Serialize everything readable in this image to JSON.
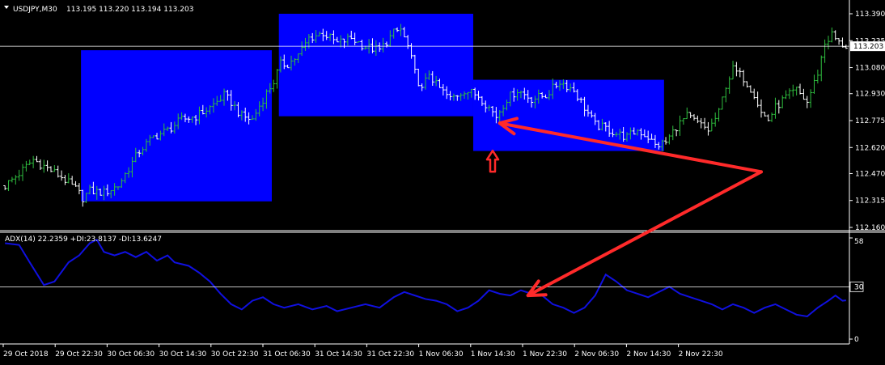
{
  "header": {
    "symbol_label": "USDJPY,M30",
    "ohlc_label": "113.195 113.220 113.194 113.203",
    "menu_icon": "triangle-down-icon"
  },
  "indicator": {
    "label": "ADX(14) 22.2359 +DI:23.8137 -DI:13.6247"
  },
  "colors": {
    "background": "#000000",
    "bull_bar": "#2fbf3f",
    "bear_bar": "#ffffff",
    "zone": "#0000ff",
    "adx_line": "#1010e0",
    "arrow": "#ff2a2a",
    "axis_text": "#ffffff",
    "price_tag_bg": "#ffffff",
    "price_tag_text": "#000000"
  },
  "chart_data": [
    {
      "type": "ohlc",
      "title": "USDJPY,M30",
      "x_labels": [
        "29 Oct 2018",
        "29 Oct 22:30",
        "30 Oct 06:30",
        "30 Oct 14:30",
        "30 Oct 22:30",
        "31 Oct 06:30",
        "31 Oct 14:30",
        "31 Oct 22:30",
        "1 Nov 06:30",
        "1 Nov 14:30",
        "1 Nov 22:30",
        "2 Nov 06:30",
        "2 Nov 14:30",
        "2 Nov 22:30"
      ],
      "y_ticks": [
        "113.390",
        "113.235",
        "113.080",
        "112.930",
        "112.775",
        "112.620",
        "112.470",
        "112.315",
        "112.160"
      ],
      "ylim": [
        112.16,
        113.39
      ],
      "current_price": "113.203",
      "close_path": [
        [
          0,
          112.4
        ],
        [
          4,
          112.47
        ],
        [
          8,
          112.55
        ],
        [
          12,
          112.5
        ],
        [
          16,
          112.45
        ],
        [
          20,
          112.38
        ],
        [
          22,
          112.33
        ],
        [
          24,
          112.37
        ],
        [
          28,
          112.36
        ],
        [
          32,
          112.4
        ],
        [
          35,
          112.5
        ],
        [
          38,
          112.6
        ],
        [
          42,
          112.68
        ],
        [
          46,
          112.72
        ],
        [
          50,
          112.78
        ],
        [
          54,
          112.8
        ],
        [
          58,
          112.85
        ],
        [
          62,
          112.92
        ],
        [
          64,
          112.88
        ],
        [
          67,
          112.8
        ],
        [
          70,
          112.78
        ],
        [
          73,
          112.9
        ],
        [
          76,
          113.0
        ],
        [
          78,
          113.1
        ],
        [
          80,
          113.1
        ],
        [
          83,
          113.15
        ],
        [
          86,
          113.25
        ],
        [
          90,
          113.28
        ],
        [
          94,
          113.22
        ],
        [
          98,
          113.25
        ],
        [
          102,
          113.2
        ],
        [
          106,
          113.18
        ],
        [
          110,
          113.28
        ],
        [
          112,
          113.3
        ],
        [
          114,
          113.2
        ],
        [
          116,
          113.05
        ],
        [
          118,
          112.95
        ],
        [
          120,
          113.05
        ],
        [
          122,
          112.98
        ],
        [
          126,
          112.9
        ],
        [
          130,
          112.95
        ],
        [
          134,
          112.92
        ],
        [
          137,
          112.85
        ],
        [
          139,
          112.8
        ],
        [
          142,
          112.9
        ],
        [
          145,
          112.95
        ],
        [
          149,
          112.9
        ],
        [
          153,
          112.92
        ],
        [
          157,
          113.0
        ],
        [
          161,
          112.95
        ],
        [
          164,
          112.85
        ],
        [
          167,
          112.75
        ],
        [
          170,
          112.73
        ],
        [
          173,
          112.7
        ],
        [
          176,
          112.68
        ],
        [
          179,
          112.72
        ],
        [
          182,
          112.68
        ],
        [
          184,
          112.63
        ],
        [
          187,
          112.65
        ],
        [
          190,
          112.74
        ],
        [
          193,
          112.8
        ],
        [
          196,
          112.76
        ],
        [
          199,
          112.72
        ],
        [
          202,
          112.82
        ],
        [
          204,
          112.98
        ],
        [
          206,
          113.07
        ],
        [
          209,
          113.02
        ],
        [
          212,
          112.93
        ],
        [
          214,
          112.82
        ],
        [
          216,
          112.78
        ],
        [
          218,
          112.85
        ],
        [
          221,
          112.91
        ],
        [
          224,
          112.95
        ],
        [
          227,
          112.88
        ],
        [
          230,
          113.05
        ],
        [
          232,
          113.22
        ],
        [
          234,
          113.27
        ],
        [
          236,
          113.22
        ],
        [
          238,
          113.203
        ]
      ],
      "candle_count": 239
    },
    {
      "type": "line",
      "title": "ADX(14) 22.2359 +DI:23.8137 -DI:13.6247",
      "y_ticks": [
        "58",
        "30",
        "0"
      ],
      "ylim": [
        0,
        58
      ],
      "level_line": 30,
      "series": [
        {
          "name": "ADX(14)",
          "points": [
            [
              0,
              55
            ],
            [
              4,
              54
            ],
            [
              7,
              44
            ],
            [
              11,
              31
            ],
            [
              14,
              33
            ],
            [
              18,
              44
            ],
            [
              21,
              48
            ],
            [
              24,
              55
            ],
            [
              26,
              57
            ],
            [
              28,
              50
            ],
            [
              31,
              48
            ],
            [
              34,
              50
            ],
            [
              37,
              47
            ],
            [
              40,
              50
            ],
            [
              43,
              45
            ],
            [
              46,
              48
            ],
            [
              48,
              44
            ],
            [
              52,
              42
            ],
            [
              55,
              38
            ],
            [
              58,
              33
            ],
            [
              61,
              26
            ],
            [
              64,
              20
            ],
            [
              67,
              17
            ],
            [
              70,
              22
            ],
            [
              73,
              24
            ],
            [
              76,
              20
            ],
            [
              79,
              18
            ],
            [
              83,
              20
            ],
            [
              87,
              17
            ],
            [
              91,
              19
            ],
            [
              94,
              16
            ],
            [
              98,
              18
            ],
            [
              102,
              20
            ],
            [
              106,
              18
            ],
            [
              110,
              24
            ],
            [
              113,
              27
            ],
            [
              116,
              25
            ],
            [
              119,
              23
            ],
            [
              122,
              22
            ],
            [
              125,
              20
            ],
            [
              128,
              16
            ],
            [
              131,
              18
            ],
            [
              134,
              22
            ],
            [
              137,
              28
            ],
            [
              140,
              26
            ],
            [
              143,
              25
            ],
            [
              146,
              28
            ],
            [
              149,
              26
            ],
            [
              152,
              25
            ],
            [
              155,
              20
            ],
            [
              158,
              18
            ],
            [
              161,
              15
            ],
            [
              164,
              18
            ],
            [
              167,
              25
            ],
            [
              170,
              37
            ],
            [
              173,
              33
            ],
            [
              176,
              28
            ],
            [
              179,
              26
            ],
            [
              182,
              24
            ],
            [
              185,
              27
            ],
            [
              188,
              30
            ],
            [
              191,
              26
            ],
            [
              194,
              24
            ],
            [
              197,
              22
            ],
            [
              200,
              20
            ],
            [
              203,
              17
            ],
            [
              206,
              20
            ],
            [
              209,
              18
            ],
            [
              212,
              15
            ],
            [
              215,
              18
            ],
            [
              218,
              20
            ],
            [
              221,
              17
            ],
            [
              224,
              14
            ],
            [
              227,
              13
            ],
            [
              230,
              18
            ],
            [
              233,
              22
            ],
            [
              235,
              25
            ],
            [
              237,
              22
            ],
            [
              238,
              22.2
            ]
          ]
        }
      ]
    }
  ],
  "annotations": {
    "zones": [
      {
        "from": 22,
        "to": 76,
        "high": 113.18,
        "low": 112.31
      },
      {
        "from": 78,
        "to": 133,
        "high": 113.39,
        "low": 112.8
      },
      {
        "from": 133,
        "to": 187,
        "high": 113.01,
        "low": 112.6
      }
    ],
    "up_arrow": {
      "at": 138,
      "price": 112.49
    },
    "arrows": [
      {
        "from": [
          214,
          112.48
        ],
        "to": [
          140,
          112.76
        ],
        "pane": "price",
        "to_pane": "price"
      },
      {
        "from": [
          214,
          112.48
        ],
        "to": [
          148,
          25
        ],
        "pane": "price",
        "to_pane": "indicator"
      }
    ]
  }
}
